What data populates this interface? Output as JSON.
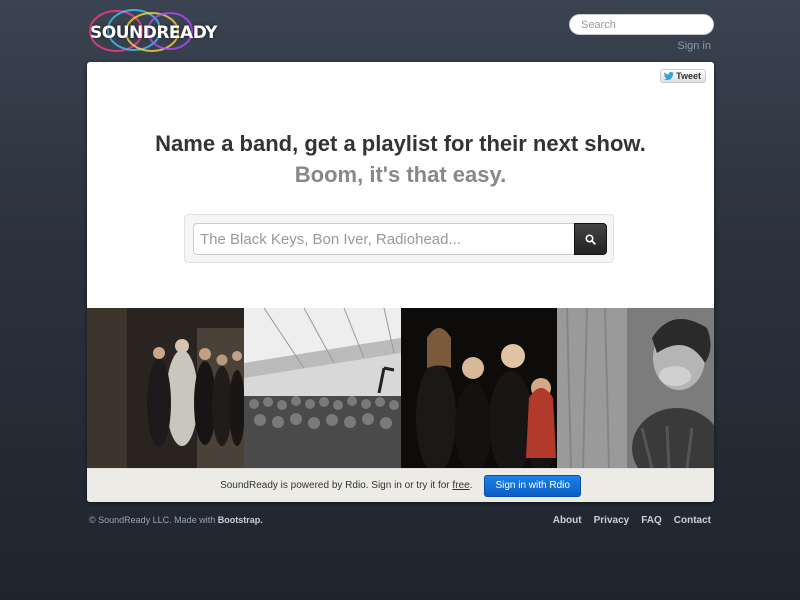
{
  "header": {
    "logo_text": "SOUNDREADY",
    "search_placeholder": "Search",
    "signin_label": "Sign in"
  },
  "card": {
    "tweet_label": "Tweet",
    "headline": "Name a band, get a playlist for their next show.",
    "subline": "Boom, it's that easy.",
    "band_input_placeholder": "The Black Keys, Bon Iver, Radiohead...",
    "search_icon": "search-icon"
  },
  "rdio": {
    "text_before": "SoundReady is powered by Rdio. Sign in or try it for",
    "free_link": "free",
    "text_after": ".",
    "button_label": "Sign in with Rdio"
  },
  "footer": {
    "copyright_prefix": "© SoundReady LLC. Made with",
    "copyright_brand": "Bootstrap.",
    "links": [
      "About",
      "Privacy",
      "FAQ",
      "Contact"
    ]
  },
  "colors": {
    "background": "#2b323d",
    "rdio_blue": "#1565d1",
    "headline": "#333333",
    "subline": "#888888"
  }
}
